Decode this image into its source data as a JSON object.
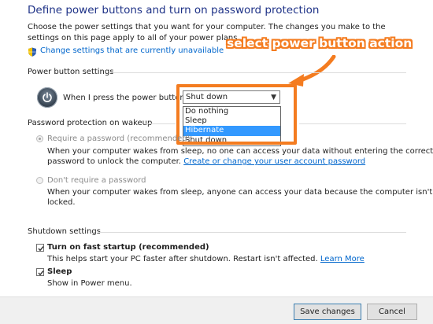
{
  "page": {
    "title": "Define power buttons and turn on password protection",
    "description": "Choose the power settings that you want for your computer. The changes you make to the settings on this page apply to all of your power plans.",
    "change_settings_link": "Change settings that are currently unavailable"
  },
  "annotation": {
    "text": "select power button action",
    "color": "#f47c20"
  },
  "power_button_settings": {
    "heading": "Power button settings",
    "when_label": "When I press the power button:",
    "selected": "Shut down",
    "options": [
      "Do nothing",
      "Sleep",
      "Hibernate",
      "Shut down"
    ],
    "highlighted_option": "Hibernate"
  },
  "password_protection": {
    "heading": "Password protection on wakeup",
    "require": {
      "label": "Require a password (recommended)",
      "desc_line1": "When your computer wakes from sleep, no one can access your data without entering the correct",
      "desc_line2_prefix": "password to unlock the computer.",
      "desc_link": "Create or change your user account password",
      "checked": true
    },
    "dont_require": {
      "label": "Don't require a password",
      "desc_line1": "When your computer wakes from sleep, anyone can access your data because the computer isn't",
      "desc_line2": "locked.",
      "checked": false
    }
  },
  "shutdown_settings": {
    "heading": "Shutdown settings",
    "fast_startup": {
      "label": "Turn on fast startup (recommended)",
      "desc_prefix": "This helps start your PC faster after shutdown. Restart isn't affected.",
      "desc_link": "Learn More",
      "checked": true
    },
    "sleep": {
      "label": "Sleep",
      "desc": "Show in Power menu.",
      "checked": true
    }
  },
  "footer": {
    "save_label": "Save changes",
    "cancel_label": "Cancel"
  },
  "colors": {
    "title": "#1e3287",
    "link": "#0066cc",
    "highlight": "#3399ff",
    "accent": "#f47c20"
  },
  "icons": {
    "shield": "uac-shield-icon",
    "power": "power-icon",
    "dropdown": "chevron-down-icon",
    "arrow": "orange-arrow-icon"
  }
}
